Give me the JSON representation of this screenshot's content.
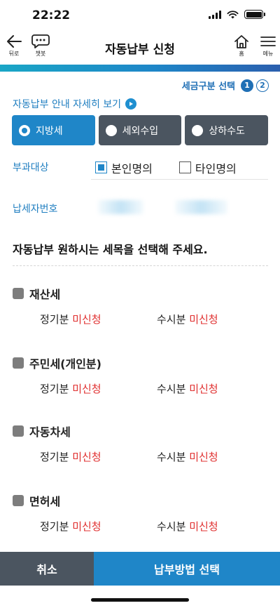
{
  "status": {
    "time": "22:22"
  },
  "header": {
    "title": "자동납부 신청",
    "back_label": "뒤로",
    "chat_label": "챗봇",
    "home_label": "홈",
    "menu_label": "메뉴"
  },
  "steps": {
    "label": "세금구분 선택",
    "current": "1",
    "next": "2"
  },
  "guide_link": "자동납부 안내 자세히 보기",
  "tax_types": [
    "지방세",
    "세외수입",
    "상하수도"
  ],
  "target": {
    "label": "부과대상",
    "self": "본인명의",
    "other": "타인명의"
  },
  "taxpayer": {
    "label": "납세자번호"
  },
  "instruction": "자동납부 원하시는 세목을 선택해 주세요.",
  "items": [
    {
      "name": "재산세",
      "regular": "정기분",
      "regular_status": "미신청",
      "occasional": "수시분",
      "occasional_status": "미신청"
    },
    {
      "name": "주민세(개인분)",
      "regular": "정기분",
      "regular_status": "미신청",
      "occasional": "수시분",
      "occasional_status": "미신청"
    },
    {
      "name": "자동차세",
      "regular": "정기분",
      "regular_status": "미신청",
      "occasional": "수시분",
      "occasional_status": "미신청"
    },
    {
      "name": "면허세",
      "regular": "정기분",
      "regular_status": "미신청",
      "occasional": "수시분",
      "occasional_status": "미신청"
    }
  ],
  "bottom": {
    "cancel": "취소",
    "method": "납부방법 선택"
  }
}
